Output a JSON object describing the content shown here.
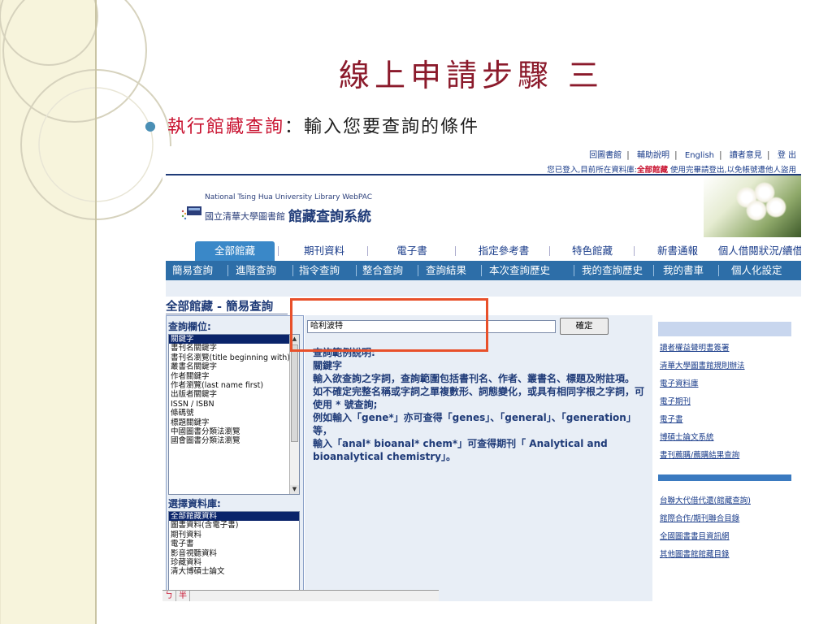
{
  "slide": {
    "title": "線上申請步驟 三",
    "bullet_highlight": "執行館藏查詢",
    "bullet_rest": "：輸入您要查詢的條件"
  },
  "colors": {
    "title": "#8B1A2B",
    "highlight": "#C8102E",
    "tab_active": "#3a88c8",
    "subnav": "#2d6ea8",
    "callout": "#E8502A"
  },
  "toplinks": [
    "回圖書館",
    "輔助說明",
    "English",
    "讀者意見",
    "登 出"
  ],
  "status": {
    "prefix": "您已登入,目前所在資料庫:",
    "db": "全部館藏",
    "suffix": " 使用完畢請登出,以免帳號遭他人盜用"
  },
  "banner": {
    "english": "National Tsing Hua University Library WebPAC",
    "chinese": "國立清華大學圖書館",
    "system": "館藏查詢系統"
  },
  "tabs": [
    "全部館藏",
    "期刊資料",
    "電子書",
    "指定參考書",
    "特色館藏",
    "新書通報",
    "個人借閱狀況/續借"
  ],
  "subnav": [
    "簡易查詢",
    "進階查詢",
    "指令查詢",
    "整合查詢",
    "查詢結果",
    "本次查詢歷史",
    "我的查詢歷史",
    "我的書車",
    "個人化設定"
  ],
  "page_heading": "全部館藏 - 簡易查詢",
  "field_label": "查詢欄位:",
  "field_options": [
    "關鍵字",
    "書刊名關鍵字",
    "書刊名瀏覽(title beginning with)",
    "叢書名關鍵字",
    "作者關鍵字",
    "作者瀏覽(last name first)",
    "出版者關鍵字",
    "ISSN / ISBN",
    "條碼號",
    "標題關鍵字",
    "中國圖書分類法瀏覽",
    "國會圖書分類法瀏覽"
  ],
  "db_label": "選擇資料庫:",
  "db_options": [
    "全部館藏資料",
    "圖書資料(含電子書)",
    "期刊資料",
    "電子書",
    "影音視聽資料",
    "珍藏資料",
    "清大博碩士論文"
  ],
  "search": {
    "value": "哈利波特",
    "submit": "確定"
  },
  "help": {
    "title": "查詢範例說明:",
    "subtitle": "關鍵字",
    "p1": "輸入欲查詢之字詞，查詢範圍包括書刊名、作者、叢書名、標題及附註項。",
    "p2": "如不確定完整名稱或字詞之單複數形、詞態變化，或具有相同字根之字詞，可使用 * 號查詢;",
    "p3": "例如輸入「gene*」亦可查得「genes」、「general」、「generation」等，",
    "p4": "輸入「anal* bioanal* chem*」可查得期刊「 Analytical and bioanalytical chemistry」。"
  },
  "right_links_top": [
    "讀者權益聲明書簽署",
    "清華大學圖書館規則辦法",
    "電子資料庫",
    "電子期刊",
    "電子書",
    "博碩士論文系統",
    "書刊薦購/薦購結果查詢"
  ],
  "right_links_bottom": [
    "台聯大代借代還(館藏查詢)",
    "館際合作/期刊聯合目錄",
    "全國圖書書目資訊網",
    "其他圖書館館藏目錄"
  ],
  "ime": [
    "ㄅ",
    "半"
  ]
}
